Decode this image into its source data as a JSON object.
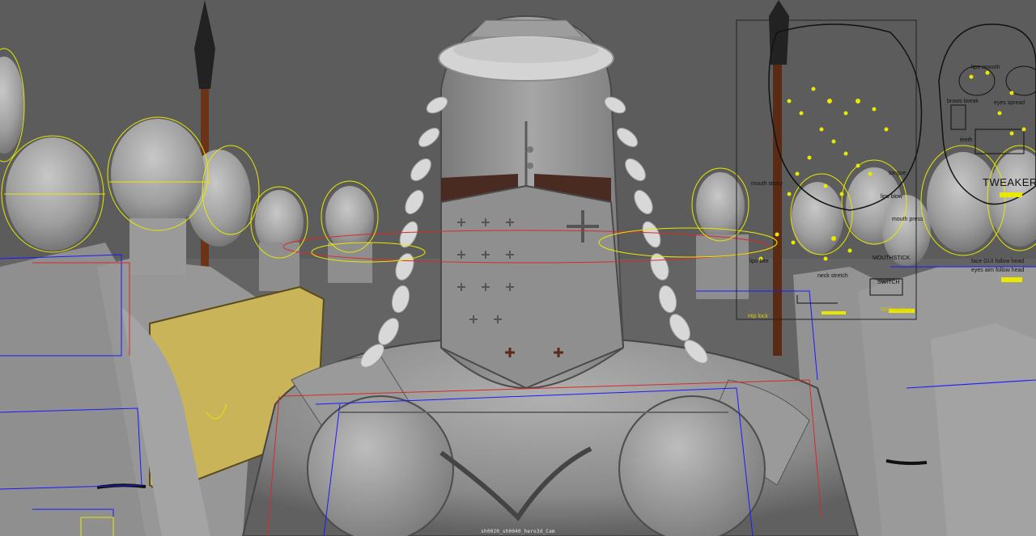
{
  "viewport": {
    "camera_label": "sh0020_sh0040_hero3d_Cam",
    "colors": {
      "background": "#5c5c5c",
      "body_shade": "#9a9a9a",
      "armor": "#8a8a8a",
      "rig_yellow": "#e8e800",
      "rig_blue": "#1a1aff",
      "rig_red": "#d92a2a",
      "shield": "#c9b45a",
      "spear_shaft": "#6b3418"
    }
  },
  "face_gui_left": {
    "labels": {
      "mouth_sticky": "mouth sticky",
      "lips_bite": "lips bite",
      "lips_blow": "lips blow",
      "tongue": "tongue",
      "mouth_press": "mouth press",
      "mouth_stick": "MOUTHSTICK",
      "neck_stretch": "neck stretch",
      "switch": "SWITCH",
      "hip_lock": "Hip lock",
      "wshoulders": "WShoulders"
    }
  },
  "face_gui_right": {
    "labels": {
      "lips_smooth": "lips smooth",
      "eye_spread": "eyes spread",
      "brows_tweak": "brows tweak",
      "teeth": "teeth",
      "tweakers": "TWEAKERS",
      "face_gui_follow_head": "face GUI follow head",
      "eyes_aim_follow_head": "eyes aim follow head"
    }
  }
}
